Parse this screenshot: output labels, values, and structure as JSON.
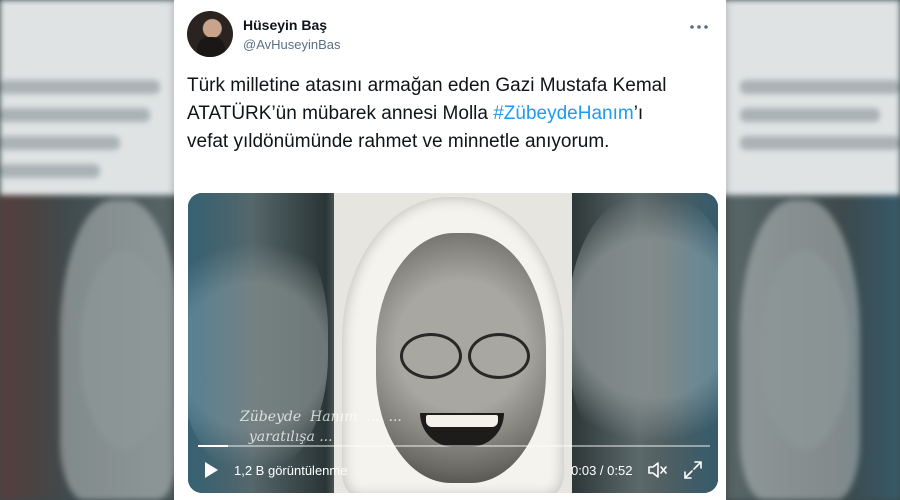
{
  "colors": {
    "accent": "#1d9bf0",
    "text": "#0f1419",
    "secondary": "#5b7083",
    "card": "#ffffff"
  },
  "tweet": {
    "author_name": "Hüseyin Baş",
    "author_handle": "@AvHuseyinBas",
    "more_icon": "more-horizontal-icon",
    "text_part1": "Türk milletine atasını armağan eden Gazi Mustafa Kemal ATATÜRK’ün mübarek annesi Molla ",
    "hashtag": "#ZübeydeHanım",
    "text_part2": "’ı vefat yıldönümünde rahmet ve minnetle anıyorum."
  },
  "video": {
    "overlay_text": "Zübeyde  Hanım  ...  ...\n  yaratılışa ...",
    "views": "1,2 B görüntülenme",
    "time": "0:03 / 0:52",
    "progress": 0.058,
    "play_icon": "play-icon",
    "mute_icon": "volume-muted-icon",
    "fullscreen_icon": "fullscreen-icon"
  }
}
